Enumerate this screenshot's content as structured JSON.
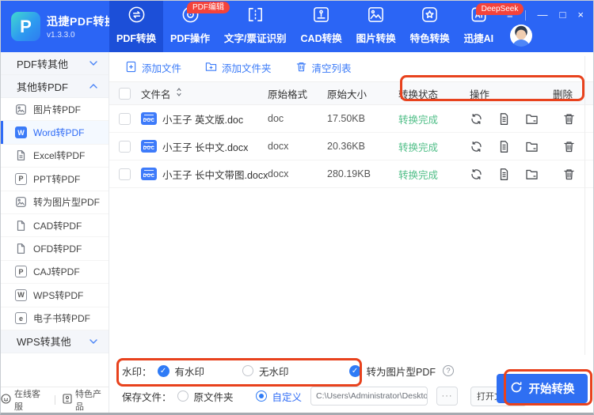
{
  "app": {
    "title": "迅捷PDF转换器",
    "version": "v1.3.3.0",
    "logo_letter": "P"
  },
  "header": {
    "tabs": [
      {
        "label": "PDF转换",
        "active": true
      },
      {
        "label": "PDF操作",
        "badge": "PDF编辑"
      },
      {
        "label": "文字/票证识别"
      },
      {
        "label": "CAD转换"
      },
      {
        "label": "图片转换"
      },
      {
        "label": "特色转换"
      },
      {
        "label": "迅捷AI",
        "badge": "DeepSeek"
      }
    ],
    "window_controls": {
      "menu": "≡",
      "minimize": "—",
      "maximize": "□",
      "close": "×"
    }
  },
  "sidebar": {
    "groups": [
      {
        "label": "PDF转其他",
        "state": "collapsed"
      },
      {
        "label": "其他转PDF",
        "state": "expanded"
      },
      {
        "label": "WPS转其他",
        "state": "collapsed"
      }
    ],
    "items": [
      {
        "label": "图片转PDF"
      },
      {
        "label": "Word转PDF",
        "glyph": "W",
        "selected": true
      },
      {
        "label": "Excel转PDF"
      },
      {
        "label": "PPT转PDF",
        "glyph": "P"
      },
      {
        "label": "转为图片型PDF"
      },
      {
        "label": "CAD转PDF"
      },
      {
        "label": "OFD转PDF"
      },
      {
        "label": "CAJ转PDF",
        "glyph": "P"
      },
      {
        "label": "WPS转PDF",
        "glyph": "W"
      },
      {
        "label": "电子书转PDF",
        "glyph": "e"
      }
    ],
    "footer": {
      "support": "在线客服",
      "products": "特色产品"
    }
  },
  "toolbar": {
    "add_file": "添加文件",
    "add_folder": "添加文件夹",
    "clear_list": "清空列表"
  },
  "table": {
    "doc_badge": "DOC",
    "headers": {
      "name": "文件名",
      "format": "原始格式",
      "size": "原始大小",
      "status": "转换状态",
      "action": "操作",
      "remove": "删除"
    },
    "rows": [
      {
        "name": "小王子 英文版.doc",
        "format": "doc",
        "size": "17.50KB",
        "status": "转换完成"
      },
      {
        "name": "小王子 长中文.docx",
        "format": "docx",
        "size": "20.36KB",
        "status": "转换完成"
      },
      {
        "name": "小王子 长中文带图.docx",
        "format": "docx",
        "size": "280.19KB",
        "status": "转换完成"
      }
    ]
  },
  "options": {
    "watermark_label": "水印：",
    "with_watermark": "有水印",
    "without_watermark": "无水印",
    "to_image_pdf": "转为图片型PDF",
    "help_glyph": "?",
    "save_label": "保存文件：",
    "original_folder": "原文件夹",
    "custom_folder": "自定义",
    "path": "C:\\Users\\Administrator\\Desktop",
    "browse": "···",
    "open_folder": "打开文件夹",
    "start_button": "开始转换"
  },
  "colors": {
    "header_blue": "#2B65F5",
    "active_tab_blue": "#1C4FD8",
    "accent_blue": "#3B7BF8",
    "badge_red": "#F4433B",
    "highlight_red": "#E8421D",
    "success_green": "#4FBE87"
  }
}
